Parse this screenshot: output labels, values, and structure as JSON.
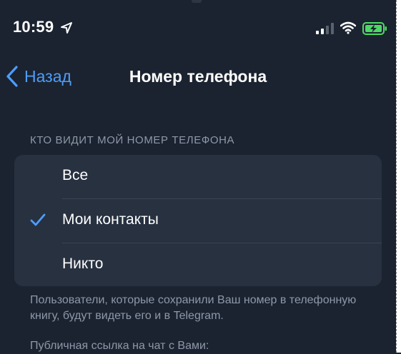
{
  "status_bar": {
    "time": "10:59",
    "location_icon": "location-arrow-icon",
    "signal_icon": "cellular-signal-icon",
    "wifi_icon": "wifi-icon",
    "battery_icon": "battery-charging-icon",
    "battery_color": "#4cd964"
  },
  "nav": {
    "back_label": "Назад",
    "title": "Номер телефона",
    "accent_color": "#4f9df8"
  },
  "section": {
    "header": "КТО ВИДИТ МОЙ НОМЕР ТЕЛЕФОНА",
    "options": [
      {
        "label": "Все",
        "selected": false
      },
      {
        "label": "Мои контакты",
        "selected": true
      },
      {
        "label": "Никто",
        "selected": false
      }
    ]
  },
  "footer": {
    "note": "Пользователи, которые сохранили Ваш номер в телефонную книгу, будут видеть его и в Telegram.",
    "public_link_label": "Публичная ссылка на чат с Вами:"
  }
}
